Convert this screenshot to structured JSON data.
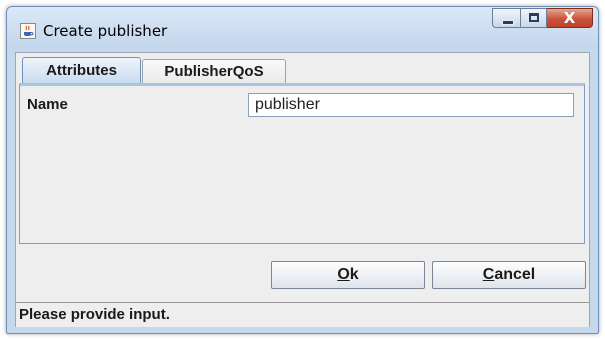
{
  "window": {
    "title": "Create publisher",
    "controls": {
      "minimize": "minimize",
      "maximize": "maximize",
      "close": "X"
    },
    "icon": "java-cup-icon"
  },
  "tabs": [
    {
      "label": "Attributes",
      "selected": true
    },
    {
      "label": "PublisherQoS",
      "selected": false
    }
  ],
  "form": {
    "name_label": "Name",
    "name_value": "publisher"
  },
  "buttons": {
    "ok_mnemonic": "O",
    "ok_rest": "k",
    "cancel_mnemonic": "C",
    "cancel_rest": "ancel"
  },
  "status": {
    "text": "Please provide input."
  },
  "colors": {
    "accent": "#c6d8ec",
    "close_button": "#c9543a"
  }
}
